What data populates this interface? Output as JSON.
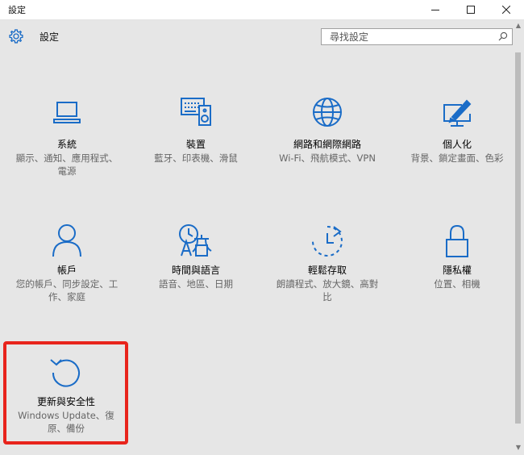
{
  "window": {
    "title": "設定",
    "controls": {
      "minimize": "minimize-icon",
      "maximize": "maximize-icon",
      "close": "close-icon"
    }
  },
  "header": {
    "title": "設定",
    "icon": "gear-icon"
  },
  "search": {
    "placeholder": "尋找設定",
    "value": ""
  },
  "accent_color": "#1a6cc7",
  "highlight_color": "#e8241c",
  "tiles": [
    {
      "label": "系統",
      "desc": "顯示、通知、應用程式、電源",
      "icon": "laptop-icon"
    },
    {
      "label": "裝置",
      "desc": "藍牙、印表機、滑鼠",
      "icon": "devices-icon"
    },
    {
      "label": "網路和網際網路",
      "desc": "Wi-Fi、飛航模式、VPN",
      "icon": "globe-icon"
    },
    {
      "label": "個人化",
      "desc": "背景、鎖定畫面、色彩",
      "icon": "personalization-icon"
    },
    {
      "label": "帳戶",
      "desc": "您的帳戶、同步設定、工作、家庭",
      "icon": "person-icon"
    },
    {
      "label": "時間與語言",
      "desc": "語音、地區、日期",
      "icon": "time-language-icon"
    },
    {
      "label": "輕鬆存取",
      "desc": "朗讀程式、放大鏡、高對比",
      "icon": "ease-of-access-icon"
    },
    {
      "label": "隱私權",
      "desc": "位置、相機",
      "icon": "lock-icon"
    },
    {
      "label": "更新與安全性",
      "desc": "Windows Update、復原、備份",
      "icon": "update-icon"
    }
  ]
}
